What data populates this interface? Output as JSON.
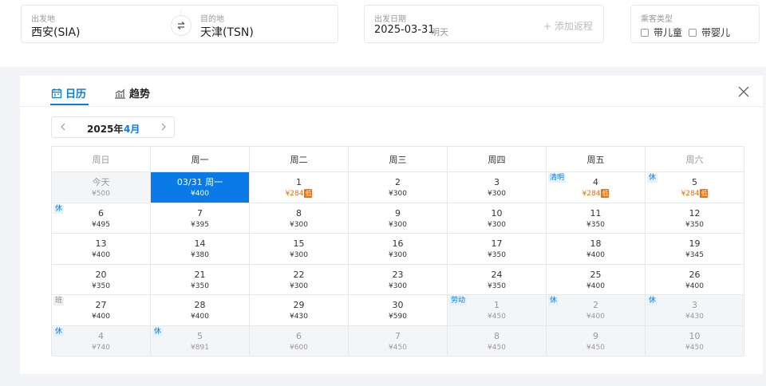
{
  "search": {
    "depart_label": "出发地",
    "depart_value": "西安(SIA)",
    "arrive_label": "目的地",
    "arrive_value": "天津(TSN)",
    "date_label": "出发日期",
    "date_value": "2025-03-31",
    "date_hint": "明天",
    "add_return": "+ 添加返程",
    "pax_label": "乘客类型",
    "pax_child": "带儿童",
    "pax_infant": "带婴儿"
  },
  "tabs": {
    "calendar": "日历",
    "trend": "趋势"
  },
  "month_nav": {
    "year": "2025年",
    "month": "4月"
  },
  "colors": {
    "accent": "#0a7ae8",
    "low": "#ff6a00"
  },
  "weekdays": [
    "周日",
    "周一",
    "周二",
    "周三",
    "周四",
    "周五",
    "周六"
  ],
  "weeks": [
    [
      {
        "day": "今天",
        "price": "¥500",
        "state": "past"
      },
      {
        "day": "03/31 周一",
        "price": "¥400",
        "state": "selected"
      },
      {
        "day": "1",
        "price": "¥284",
        "low": true,
        "low_label": "低"
      },
      {
        "day": "2",
        "price": "¥300"
      },
      {
        "day": "3",
        "price": "¥300"
      },
      {
        "day": "4",
        "price": "¥284",
        "low": true,
        "low_label": "低",
        "tag": "清明"
      },
      {
        "day": "5",
        "price": "¥284",
        "low": true,
        "low_label": "低",
        "tag": "休"
      }
    ],
    [
      {
        "day": "6",
        "price": "¥495",
        "tag": "休"
      },
      {
        "day": "7",
        "price": "¥395"
      },
      {
        "day": "8",
        "price": "¥300"
      },
      {
        "day": "9",
        "price": "¥300"
      },
      {
        "day": "10",
        "price": "¥300"
      },
      {
        "day": "11",
        "price": "¥350"
      },
      {
        "day": "12",
        "price": "¥350"
      }
    ],
    [
      {
        "day": "13",
        "price": "¥400"
      },
      {
        "day": "14",
        "price": "¥380"
      },
      {
        "day": "15",
        "price": "¥300"
      },
      {
        "day": "16",
        "price": "¥300"
      },
      {
        "day": "17",
        "price": "¥350"
      },
      {
        "day": "18",
        "price": "¥400"
      },
      {
        "day": "19",
        "price": "¥345"
      }
    ],
    [
      {
        "day": "20",
        "price": "¥350"
      },
      {
        "day": "21",
        "price": "¥350"
      },
      {
        "day": "22",
        "price": "¥300"
      },
      {
        "day": "23",
        "price": "¥300"
      },
      {
        "day": "24",
        "price": "¥350"
      },
      {
        "day": "25",
        "price": "¥400"
      },
      {
        "day": "26",
        "price": "¥400"
      }
    ],
    [
      {
        "day": "27",
        "price": "¥400",
        "tag": "班",
        "tag_type": "work"
      },
      {
        "day": "28",
        "price": "¥400"
      },
      {
        "day": "29",
        "price": "¥430"
      },
      {
        "day": "30",
        "price": "¥590"
      },
      {
        "day": "1",
        "price": "¥450",
        "state": "other",
        "tag": "劳动"
      },
      {
        "day": "2",
        "price": "¥400",
        "state": "other",
        "tag": "休"
      },
      {
        "day": "3",
        "price": "¥430",
        "state": "other",
        "tag": "休"
      }
    ],
    [
      {
        "day": "4",
        "price": "¥740",
        "state": "other",
        "tag": "休"
      },
      {
        "day": "5",
        "price": "¥891",
        "state": "other",
        "tag": "休"
      },
      {
        "day": "6",
        "price": "¥600",
        "state": "other"
      },
      {
        "day": "7",
        "price": "¥450",
        "state": "other"
      },
      {
        "day": "8",
        "price": "¥450",
        "state": "other"
      },
      {
        "day": "9",
        "price": "¥450",
        "state": "other"
      },
      {
        "day": "10",
        "price": "¥450",
        "state": "other"
      }
    ]
  ]
}
